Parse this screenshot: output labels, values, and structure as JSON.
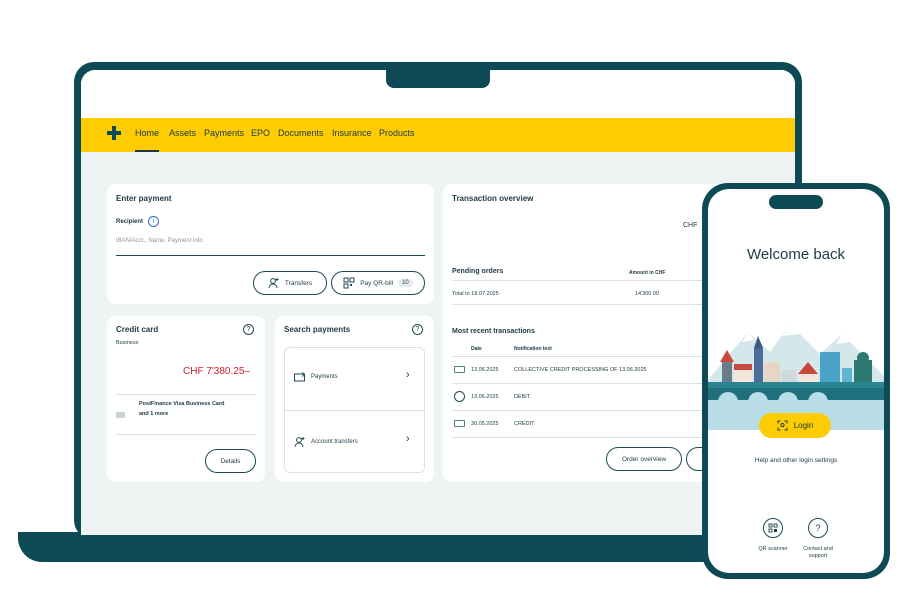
{
  "nav": {
    "items": [
      "Home",
      "Assets",
      "Payments",
      "EPO",
      "Documents",
      "Insurance",
      "Products"
    ]
  },
  "enter_payment": {
    "title": "Enter payment",
    "recipient_label": "Recipient",
    "recipient_placeholder": "IBAN/Acct., Name, Payment info",
    "transfers_label": "Transfers",
    "qr_label": "Pay QR-bill",
    "qr_count": "10"
  },
  "credit_card": {
    "title": "Credit card",
    "subtitle": "Business",
    "amount": "CHF 7'380.25–",
    "card_name_line1": "PostFinance Visa Business Card",
    "card_name_line2": "and 1 more",
    "details_label": "Details"
  },
  "search_payments": {
    "title": "Search payments",
    "items": [
      "Payments",
      "Account transfers"
    ]
  },
  "transaction_overview": {
    "title": "Transaction overview",
    "currency": "CHF",
    "pending_title": "Pending orders",
    "amount_header": "Amount in CHF",
    "pending_row_label": "Total to 18.07.2025",
    "pending_row_amount": "14'300.00",
    "recent_title": "Most recent transactions",
    "col_date": "Date",
    "col_text": "Notification text",
    "transactions": [
      {
        "date": "13.06.2025",
        "text": "COLLECTIVE CREDIT PROCESSING OF 13.06.2025"
      },
      {
        "date": "13.06.2025",
        "text": "DEBIT"
      },
      {
        "date": "30.05.2025",
        "text": "CREDIT"
      }
    ],
    "order_overview_label": "Order overview"
  },
  "phone": {
    "title": "Welcome back",
    "login_label": "Login",
    "help_link": "Help and other login settings",
    "qr_scanner_label": "QR scanner",
    "contact_line1": "Contact and",
    "contact_line2": "support"
  },
  "colors": {
    "brand_yellow": "#fdcc03",
    "dark_teal": "#0e4a55",
    "text": "#1d3a44",
    "alert_red": "#d6202f",
    "background": "#eef3f4"
  }
}
